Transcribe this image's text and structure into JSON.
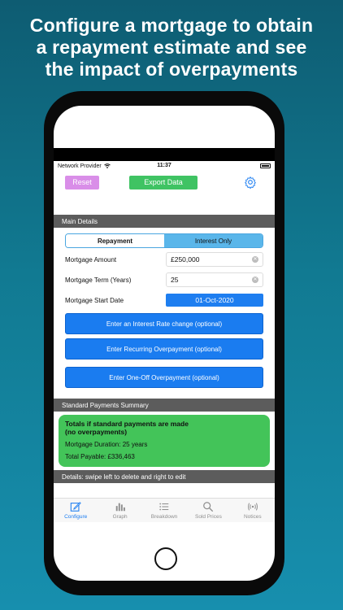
{
  "headline": "Configure a mortgage to obtain\na repayment estimate and see\nthe impact of overpayments",
  "status": {
    "carrier": "Network Provider",
    "time": "11:37"
  },
  "toolbar": {
    "reset_label": "Reset",
    "export_label": "Export Data"
  },
  "main_details": {
    "header": "Main Details",
    "segments": [
      {
        "label": "Repayment",
        "selected": true
      },
      {
        "label": "Interest Only",
        "selected": false
      }
    ],
    "mortgage_amount": {
      "label": "Mortgage Amount",
      "value": "£250,000"
    },
    "mortgage_term": {
      "label": "Mortgage Term (Years)",
      "value": "25"
    },
    "start_date": {
      "label": "Mortgage Start Date",
      "value": "01-Oct-2020"
    },
    "interest_rate_button": "Enter an Interest Rate change (optional)",
    "recurring_button": "Enter Recurring Overpayment (optional)",
    "oneoff_button": "Enter One-Off Overpayment (optional)"
  },
  "standard_summary": {
    "header": "Standard Payments Summary",
    "title": "Totals if standard payments are made\n(no overpayments)",
    "duration": "Mortgage Duration: 25 years",
    "total_payable": "Total Payable: £336,463"
  },
  "details": {
    "header": "Details: swipe left to delete and right to edit"
  },
  "tabbar": {
    "items": [
      {
        "label": "Configure",
        "icon": "edit-icon",
        "active": true
      },
      {
        "label": "Graph",
        "icon": "bar-chart-icon",
        "active": false
      },
      {
        "label": "Breakdown",
        "icon": "list-icon",
        "active": false
      },
      {
        "label": "Sold Prices",
        "icon": "search-icon",
        "active": false
      },
      {
        "label": "Notices",
        "icon": "broadcast-icon",
        "active": false
      }
    ]
  },
  "colors": {
    "background": "#117a92",
    "accent_blue": "#1a7cf0",
    "export_green": "#3fc363",
    "reset_pink": "#d98ee8",
    "summary_green": "#43c459",
    "section_gray": "#5c5c5c"
  }
}
